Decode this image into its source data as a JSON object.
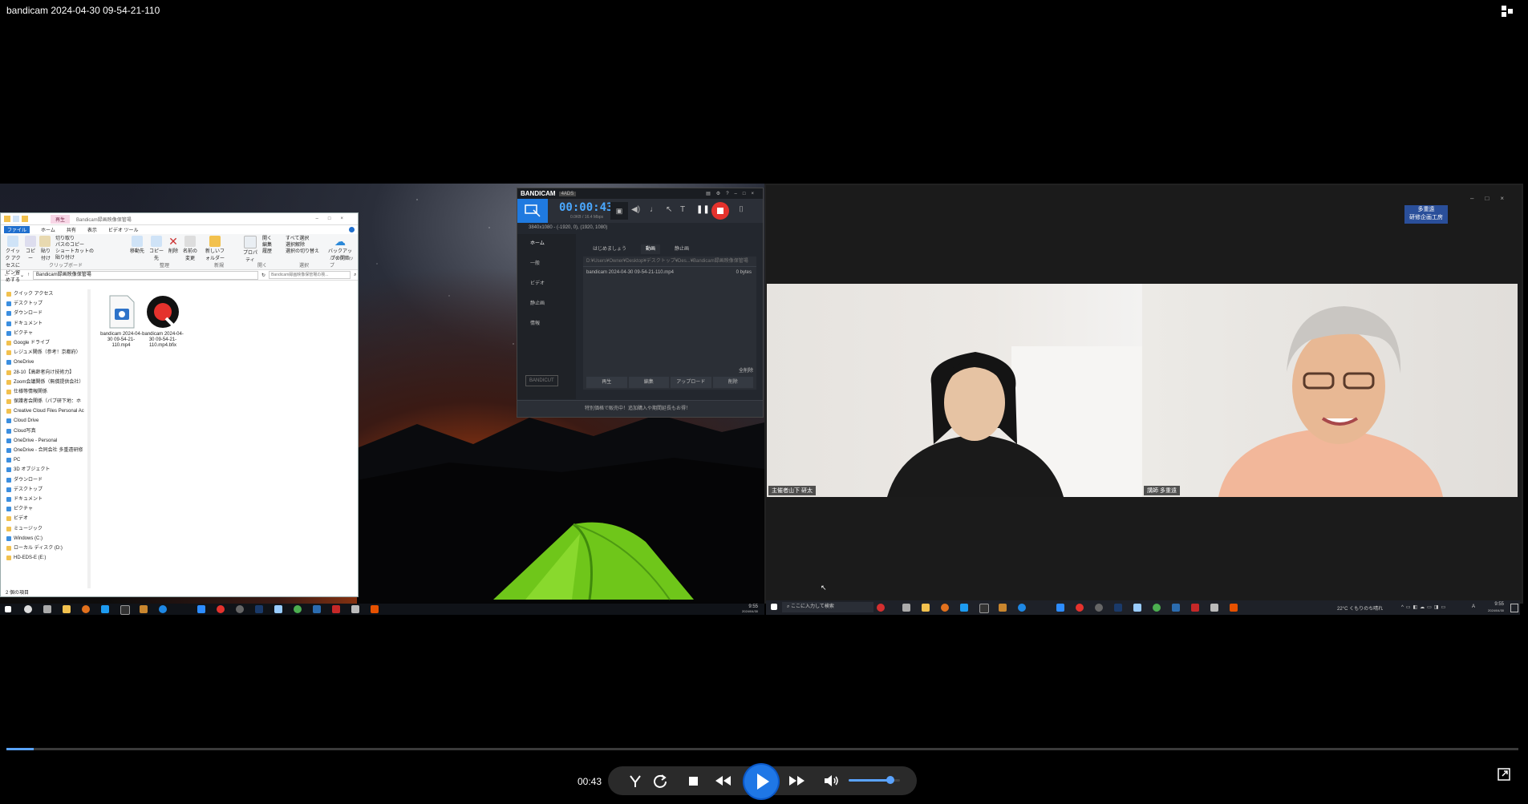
{
  "player": {
    "title": "bandicam 2024-04-30 09-54-21-110",
    "current_time": "00:43",
    "progress_fraction": 0.018,
    "volume_fraction": 0.82
  },
  "explorer": {
    "title": "Bandicam録画映像保管場",
    "context_tab": "再生",
    "tabs": [
      "ファイル",
      "ホーム",
      "共有",
      "表示",
      "ビデオ ツール"
    ],
    "ribbon_groups": [
      "クリップボード",
      "整理",
      "新規",
      "開く",
      "選択"
    ],
    "ribbon_labels": [
      "クイック アクセスにピン留めする",
      "コピー",
      "貼り付け",
      "切り取り",
      "パスのコピー",
      "ショートカットの貼り付け",
      "移動先",
      "コピー先",
      "削除",
      "名前の変更",
      "新しいフォルダー",
      "プロパティ",
      "開く",
      "編集",
      "履歴",
      "すべて選択",
      "選択解除",
      "選択の切り替え",
      "バックアップの開始"
    ],
    "backup_group": "バックアップ",
    "address": "Bandicam録画映像保管場",
    "search_placeholder": "Bandicam録画映像保管場の検...",
    "nav_items": [
      "クイック アクセス",
      "デスクトップ",
      "ダウンロード",
      "ドキュメント",
      "ピクチャ",
      "Google ドライブ",
      "レジュメ関係（参考！京都府）",
      "OneDrive",
      "28-10【高齢者向け技術力】",
      "Zoom会議関係（無償提供会社）",
      "仕様等情報関係",
      "保護者会関係（パブ研下地：ホ",
      "Creative Cloud Files Personal Ac",
      "Cloud Drive",
      "Cloud写真",
      "OneDrive - Personal",
      "OneDrive - 合同会社 多重遠研修",
      "PC",
      "3D オブジェクト",
      "ダウンロード",
      "デスクトップ",
      "ドキュメント",
      "ピクチャ",
      "ビデオ",
      "ミュージック",
      "Windows (C:)",
      "ローカル ディスク (D:)",
      "HD-EDS-E (E:)"
    ],
    "files": [
      {
        "name": "bandicam 2024-04-30 09-54-21-110.mp4"
      },
      {
        "name": "bandicam 2024-04-30 09-54-21-110.mp4.bfix"
      }
    ],
    "status": "2 個の項目"
  },
  "bandicam": {
    "logo": "BANDICAM",
    "badge": "4ADS",
    "timer": "00:00:43",
    "size_info": "0.0KB / 16.4 Mbps",
    "resolution_info": "3840x1080 - (-1920, 0), (1920, 1080)",
    "sidebar": [
      "ホーム",
      "一般",
      "ビデオ",
      "静止画",
      "情報"
    ],
    "tabs": [
      "はじめましょう",
      "動画",
      "静止画"
    ],
    "path": "D:¥Users¥Owner¥Desktop¥デスクトップ¥Des...¥Bandicam録画映像保管場",
    "file_name": "bandicam 2024-04-30 09-54-21-110.mp4",
    "file_size": "0 bytes",
    "delete_label": "全削除",
    "actions": [
      "再生",
      "編集",
      "アップロード",
      "削除"
    ],
    "bandicut": "BANDICUT",
    "footer": "特別価格で販売中！追加購入や期間延長もお得！"
  },
  "zoom": {
    "badge_line1": "多重遠",
    "badge_line2": "研修企画工房",
    "participant_a": "主催者山下 研太",
    "participant_b": "講師 多重遠"
  },
  "taskbars": {
    "left_time": "9:55",
    "left_date": "2024/04/30",
    "right_search": "ここに入力して検索",
    "right_weather": "22°C くもりのち晴れ",
    "right_time": "9:55",
    "right_date": "2024/04/30",
    "right_ime": "A"
  }
}
